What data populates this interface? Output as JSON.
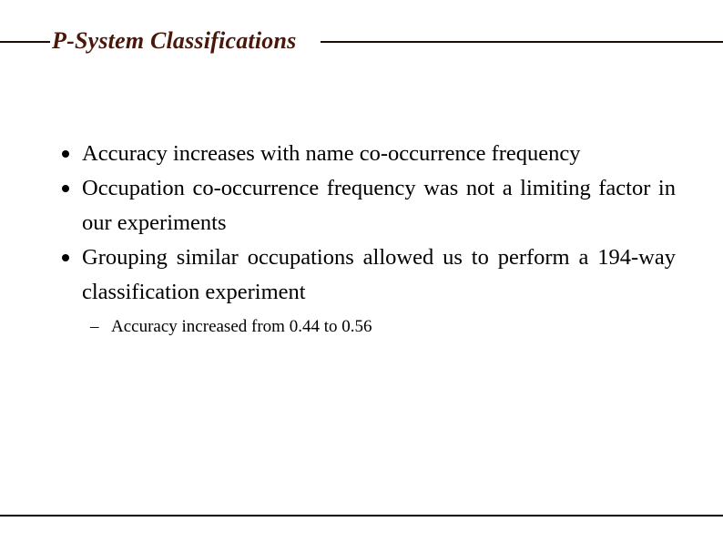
{
  "slide": {
    "title": "P-System Classifications",
    "title_color": "#4a180b",
    "rule_color": "#1a0d07",
    "footer_rule_color": "#000000",
    "background_color": "#ffffff",
    "text_color": "#000000",
    "bullets": [
      {
        "marker": "bullet-dot",
        "text": "Accuracy increases with name co-occurrence frequency"
      },
      {
        "marker": "bullet-dot",
        "text": "Occupation co-occurrence frequency was not a limiting factor in our experiments"
      },
      {
        "marker": "bullet-dot",
        "text": "Grouping similar occupations allowed us to perform a 194-way classification experiment"
      }
    ],
    "sub_bullets": [
      {
        "marker": "–",
        "text": "Accuracy increased from 0.44 to 0.56"
      }
    ]
  }
}
